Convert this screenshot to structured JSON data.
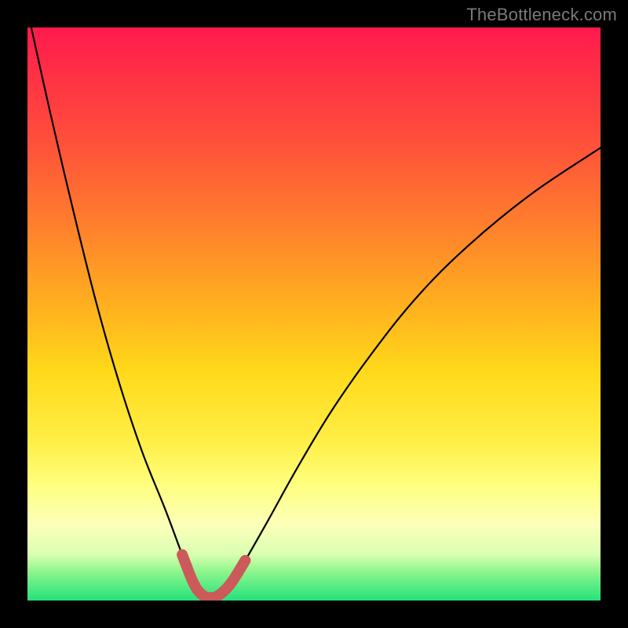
{
  "watermark": "TheBottleneck.com",
  "chart_data": {
    "type": "line",
    "title": "",
    "xlabel": "",
    "ylabel": "",
    "xlim": [
      0,
      100
    ],
    "ylim": [
      0,
      100
    ],
    "grid": false,
    "series": [
      {
        "name": "bottleneck-curve",
        "x": [
          0,
          4,
          8,
          12,
          16,
          20,
          24,
          27,
          29,
          30.5,
          32,
          33.5,
          35.5,
          38,
          42,
          47,
          53,
          60,
          68,
          77,
          88,
          100
        ],
        "y": [
          103,
          85,
          68,
          52,
          38,
          26,
          16,
          8,
          3,
          1,
          0.5,
          1,
          3,
          7,
          14,
          23,
          33,
          43,
          53,
          62,
          71,
          79
        ]
      },
      {
        "name": "highlight-band",
        "x": [
          27,
          29,
          30.5,
          32,
          33.5,
          35.5,
          38
        ],
        "y": [
          8,
          3,
          1,
          0.5,
          1,
          3,
          7
        ]
      }
    ],
    "colors": {
      "curve": "#000000",
      "highlight": "#cc5a5a",
      "gradient_top": "#ff1a4d",
      "gradient_bottom": "#24e27b"
    }
  }
}
